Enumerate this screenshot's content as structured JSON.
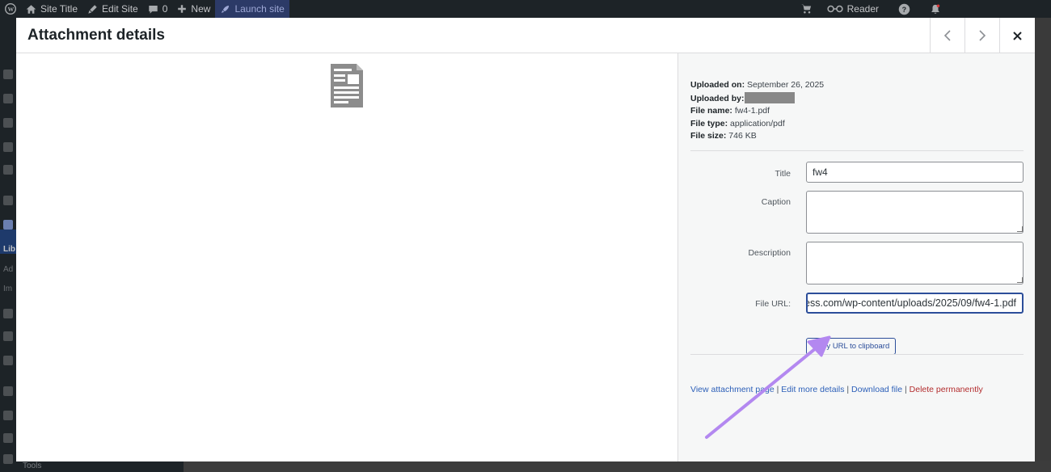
{
  "adminbar": {
    "site_title": "Site Title",
    "edit_site": "Edit Site",
    "comments_count": "0",
    "new_label": "New",
    "launch_label": "Launch site",
    "reader_label": "Reader"
  },
  "adminmenu": {
    "lib_label": "Lib",
    "ad_label": "Ad",
    "im_label": "Im",
    "tools_label": "Tools"
  },
  "modal": {
    "title": "Attachment details"
  },
  "meta": {
    "uploaded_on_label": "Uploaded on:",
    "uploaded_on_value": "September 26, 2025",
    "uploaded_by_label": "Uploaded by:",
    "file_name_label": "File name:",
    "file_name_value": "fw4-1.pdf",
    "file_type_label": "File type:",
    "file_type_value": "application/pdf",
    "file_size_label": "File size:",
    "file_size_value": "746 KB"
  },
  "fields": {
    "title_label": "Title",
    "title_value": "fw4",
    "caption_label": "Caption",
    "caption_value": "",
    "description_label": "Description",
    "description_value": "",
    "file_url_label": "File URL:",
    "file_url_value": "ess.com/wp-content/uploads/2025/09/fw4-1.pdf",
    "copy_button": "Copy URL to clipboard"
  },
  "actions": {
    "view": "View attachment page",
    "edit": "Edit more details",
    "download": "Download file",
    "delete": "Delete permanently"
  },
  "colors": {
    "accent": "#2c4e9a",
    "link": "#2c5fb8",
    "danger": "#b32d2e",
    "annotation_arrow": "#b388f0"
  }
}
